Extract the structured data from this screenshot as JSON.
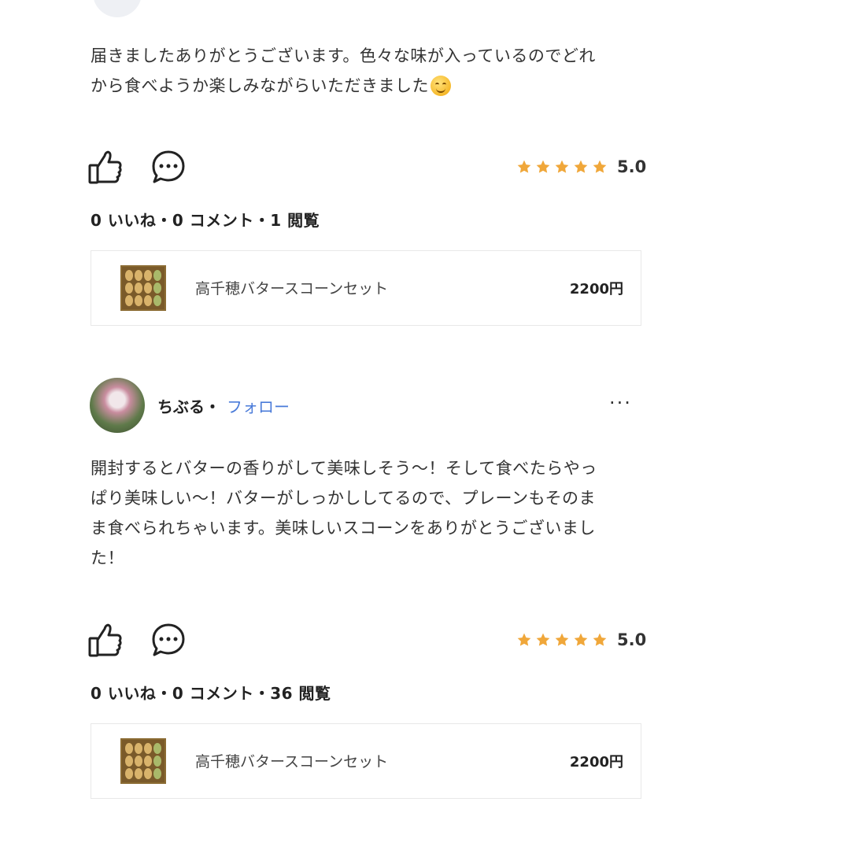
{
  "reviews": [
    {
      "text": "届きましたありがとうございます。色々な味が入っているのでどれ\nから食べようか楽しみながらいただきました",
      "has_emoji": true,
      "rating": "5.0",
      "stats": "0 いいね・0 コメント・1 閲覧",
      "product": {
        "name": "高千穂バタースコーンセット",
        "price": "2200円"
      }
    },
    {
      "user": {
        "name": "ちぶる・",
        "follow_label": "フォロー",
        "more_label": "···"
      },
      "text": "開封するとバターの香りがして美味しそう〜！そして食べたらやっ\nぱり美味しい〜！バターがしっかししてるので、プレーンもそのま\nま食べられちゃいます。美味しいスコーンをありがとうございまし\nた！",
      "rating": "5.0",
      "stats": "0 いいね・0 コメント・36 閲覧",
      "product": {
        "name": "高千穂バタースコーンセット",
        "price": "2200円"
      }
    }
  ],
  "colors": {
    "star": "#f0a73a",
    "follow": "#4a7bd9",
    "card_border": "#e8e8e8"
  },
  "icons": [
    "thumbs-up-icon",
    "comment-icon",
    "star-icon",
    "more-icon",
    "smile-emoji"
  ]
}
